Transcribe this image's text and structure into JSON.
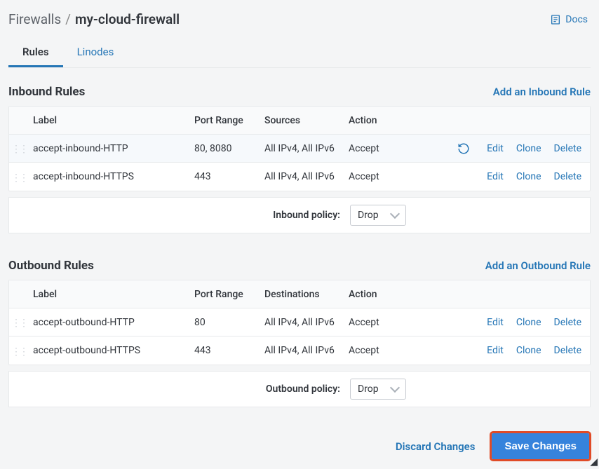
{
  "breadcrumb": {
    "root": "Firewalls",
    "current": "my-cloud-firewall"
  },
  "docs_label": "Docs",
  "tabs": {
    "rules": "Rules",
    "linodes": "Linodes"
  },
  "inbound": {
    "title": "Inbound Rules",
    "add_link": "Add an Inbound Rule",
    "headers": {
      "label": "Label",
      "port": "Port Range",
      "src": "Sources",
      "action": "Action"
    },
    "rows": [
      {
        "label": "accept-inbound-HTTP",
        "port": "80, 8080",
        "src": "All IPv4, All IPv6",
        "action": "Accept",
        "undo": true
      },
      {
        "label": "accept-inbound-HTTPS",
        "port": "443",
        "src": "All IPv4, All IPv6",
        "action": "Accept",
        "undo": false
      }
    ],
    "policy_label": "Inbound policy:",
    "policy_value": "Drop"
  },
  "outbound": {
    "title": "Outbound Rules",
    "add_link": "Add an Outbound Rule",
    "headers": {
      "label": "Label",
      "port": "Port Range",
      "src": "Destinations",
      "action": "Action"
    },
    "rows": [
      {
        "label": "accept-outbound-HTTP",
        "port": "80",
        "src": "All IPv4, All IPv6",
        "action": "Accept",
        "undo": false
      },
      {
        "label": "accept-outbound-HTTPS",
        "port": "443",
        "src": "All IPv4, All IPv6",
        "action": "Accept",
        "undo": false
      }
    ],
    "policy_label": "Outbound policy:",
    "policy_value": "Drop"
  },
  "ops": {
    "edit": "Edit",
    "clone": "Clone",
    "delete": "Delete"
  },
  "footer": {
    "discard": "Discard Changes",
    "save": "Save Changes"
  }
}
